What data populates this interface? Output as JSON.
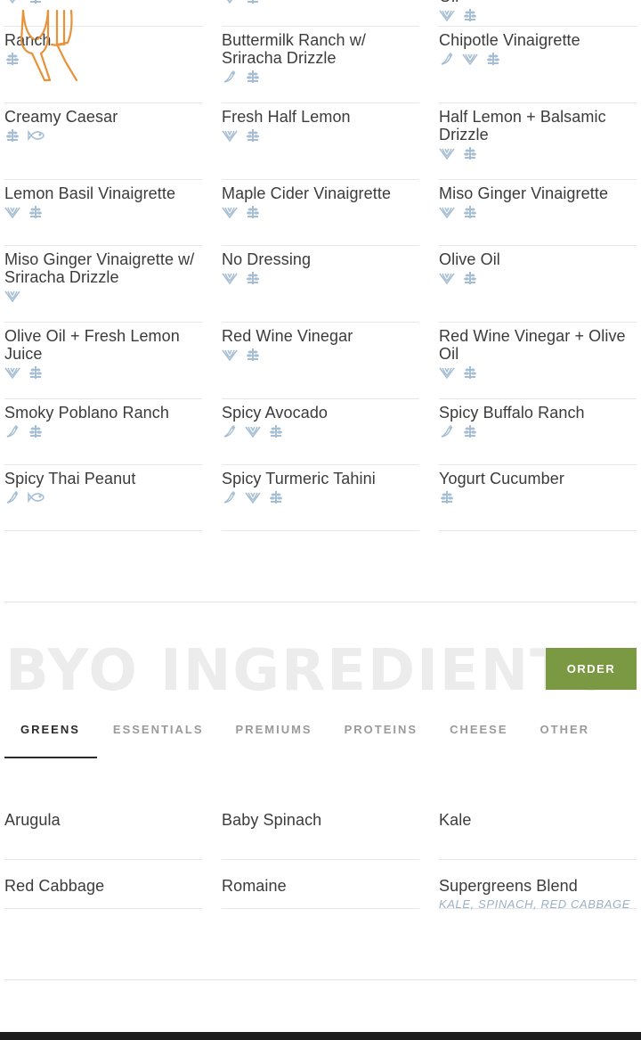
{
  "colors": {
    "accent": "#7b9943",
    "icon": "#a5bed3",
    "spicy": "#a5bed3",
    "orange": "#e8923a"
  },
  "dressings": [
    {
      "name": "",
      "icons": [
        "vegetarian",
        "gluten-free"
      ]
    },
    {
      "name": "",
      "icons": [
        "vegetarian",
        "gluten-free"
      ]
    },
    {
      "name": "Oil",
      "icons": [
        "vegetarian",
        "gluten-free"
      ]
    },
    {
      "name": "Ranch",
      "icons": [
        "gluten-free"
      ]
    },
    {
      "name": "Buttermilk Ranch w/ Sriracha Drizzle",
      "icons": [
        "spicy",
        "gluten-free"
      ]
    },
    {
      "name": "Chipotle Vinaigrette",
      "icons": [
        "spicy",
        "vegetarian",
        "gluten-free"
      ]
    },
    {
      "name": "Creamy Caesar",
      "icons": [
        "gluten-free",
        "fish"
      ]
    },
    {
      "name": "Fresh Half Lemon",
      "icons": [
        "vegetarian",
        "gluten-free"
      ]
    },
    {
      "name": "Half Lemon + Balsamic Drizzle",
      "icons": [
        "vegetarian",
        "gluten-free"
      ]
    },
    {
      "name": "Lemon Basil Vinaigrette",
      "icons": [
        "vegetarian",
        "gluten-free"
      ]
    },
    {
      "name": "Maple Cider Vinaigrette",
      "icons": [
        "vegetarian",
        "gluten-free"
      ]
    },
    {
      "name": "Miso Ginger Vinaigrette",
      "icons": [
        "vegetarian",
        "gluten-free"
      ]
    },
    {
      "name": "Miso Ginger Vinaigrette w/ Sriracha Drizzle",
      "icons": [
        "vegetarian"
      ]
    },
    {
      "name": "No Dressing",
      "icons": [
        "vegetarian",
        "gluten-free"
      ]
    },
    {
      "name": "Olive Oil",
      "icons": [
        "vegetarian",
        "gluten-free"
      ]
    },
    {
      "name": "Olive Oil + Fresh Lemon Juice",
      "icons": [
        "vegetarian",
        "gluten-free"
      ]
    },
    {
      "name": "Red Wine Vinegar",
      "icons": [
        "vegetarian",
        "gluten-free"
      ]
    },
    {
      "name": "Red Wine Vinegar + Olive Oil",
      "icons": [
        "vegetarian",
        "gluten-free"
      ]
    },
    {
      "name": "Smoky Poblano Ranch",
      "icons": [
        "spicy",
        "gluten-free"
      ]
    },
    {
      "name": "Spicy Avocado",
      "icons": [
        "spicy",
        "vegetarian",
        "gluten-free"
      ]
    },
    {
      "name": "Spicy Buffalo Ranch",
      "icons": [
        "spicy",
        "gluten-free"
      ]
    },
    {
      "name": "Spicy Thai Peanut",
      "icons": [
        "spicy",
        "fish"
      ]
    },
    {
      "name": "Spicy Turmeric Tahini",
      "icons": [
        "spicy",
        "vegetarian",
        "gluten-free"
      ]
    },
    {
      "name": "Yogurt Cucumber",
      "icons": [
        "gluten-free"
      ]
    }
  ],
  "byo": {
    "title": "BYO INGREDIENTS",
    "order_label": "ORDER",
    "tabs": [
      "GREENS",
      "ESSENTIALS",
      "PREMIUMS",
      "PROTEINS",
      "CHEESE",
      "OTHER"
    ],
    "active_tab": "GREENS"
  },
  "greens": [
    {
      "name": "Arugula",
      "sub": ""
    },
    {
      "name": "Baby Spinach",
      "sub": ""
    },
    {
      "name": "Kale",
      "sub": ""
    },
    {
      "name": "Red Cabbage",
      "sub": ""
    },
    {
      "name": "Romaine",
      "sub": ""
    },
    {
      "name": "Supergreens Blend",
      "sub": "KALE, SPINACH, RED CABBAGE"
    }
  ]
}
